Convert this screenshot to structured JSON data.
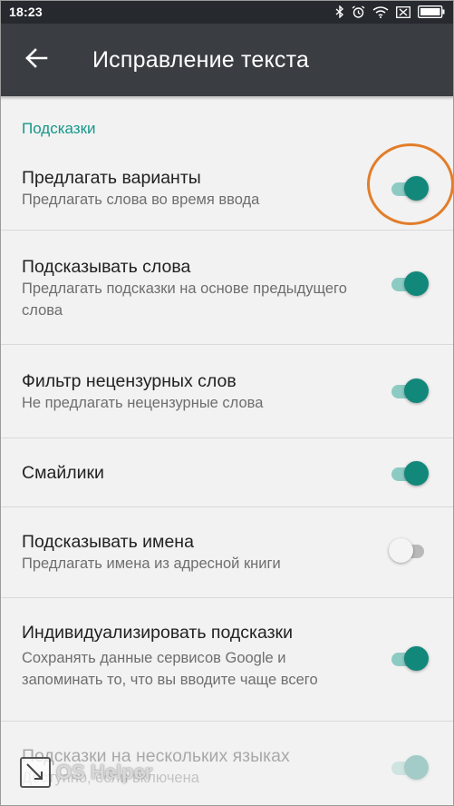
{
  "status_bar": {
    "time": "18:23",
    "icons": [
      "bluetooth-icon",
      "alarm-icon",
      "wifi-icon",
      "sim-off-icon",
      "battery-icon"
    ]
  },
  "app_bar": {
    "back_icon": "arrow-left-icon",
    "title": "Исправление текста"
  },
  "section": {
    "header": "Подсказки",
    "accent_color": "#16978a"
  },
  "settings": [
    {
      "title": "Предлагать варианты",
      "summary": "Предлагать слова во время ввода",
      "enabled": true
    },
    {
      "title": "Подсказывать слова",
      "summary": "Предлагать подсказки на основе предыдущего слова",
      "enabled": true
    },
    {
      "title": "Фильтр нецензурных слов",
      "summary": "Не предлагать нецензурные слова",
      "enabled": true
    },
    {
      "title": "Смайлики",
      "summary": "",
      "enabled": true
    },
    {
      "title": "Подсказывать имена",
      "summary": "Предлагать имена из адресной книги",
      "enabled": false
    },
    {
      "title": "Индивидуализировать подсказки",
      "summary": "Сохранять данные сервисов Google и запоминать то, что вы вводите чаще всего",
      "enabled": true
    },
    {
      "title": "Подсказки на нескольких языках",
      "summary": "Доступно, если включена",
      "enabled": true
    }
  ],
  "highlight_color": "#e27d2a",
  "watermark": {
    "text": "OS Helper"
  }
}
